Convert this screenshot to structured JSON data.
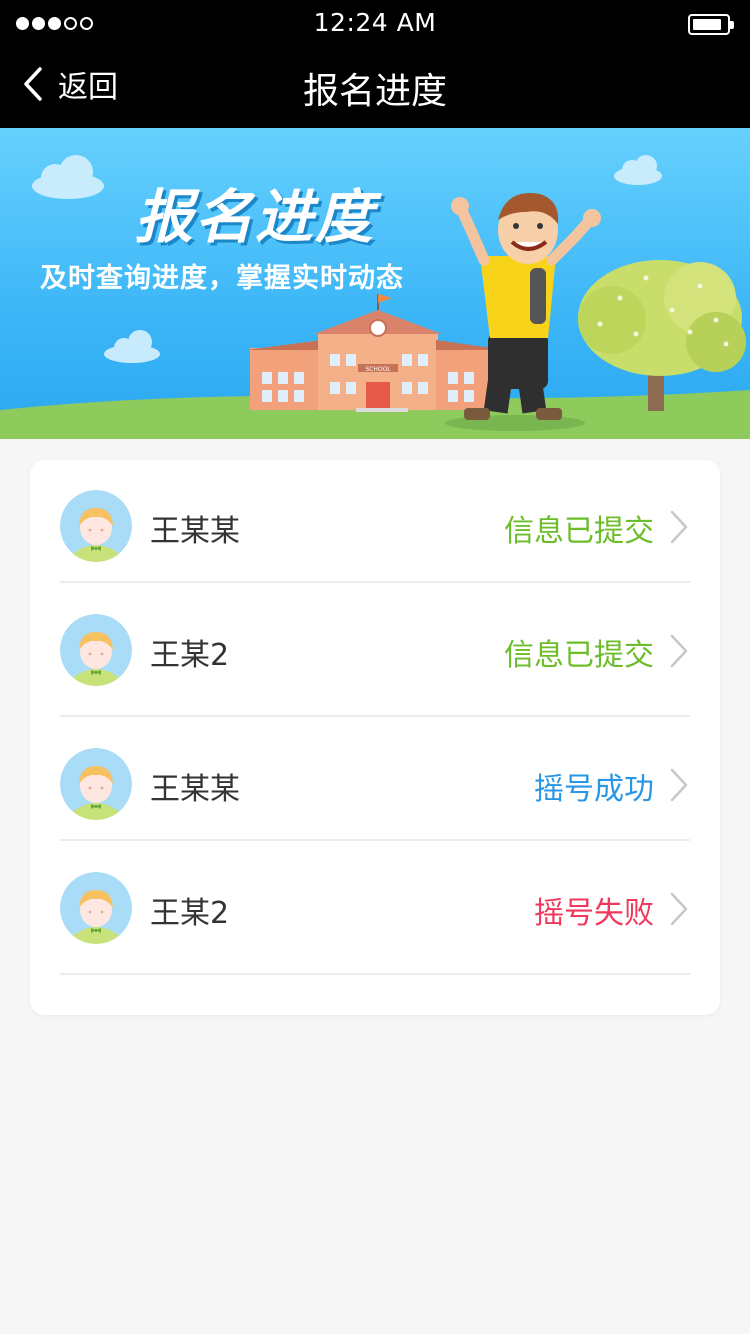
{
  "status_bar": {
    "time": "12:24 AM",
    "signal_bars": 3,
    "signal_total": 5
  },
  "nav": {
    "back_label": "返回",
    "title": "报名进度"
  },
  "banner": {
    "title": "报名进度",
    "subtitle": "及时查询进度，掌握实时动态",
    "building_sign": "SCHOOL"
  },
  "colors": {
    "submitted": "#6bbd2a",
    "success": "#2a96e6",
    "failed": "#f0385c",
    "nav_bg": "#000000"
  },
  "records": [
    {
      "name": "王某某",
      "status": "信息已提交",
      "status_type": "submitted"
    },
    {
      "name": "王某2",
      "status": "信息已提交",
      "status_type": "submitted"
    },
    {
      "name": "王某某",
      "status": "摇号成功",
      "status_type": "success"
    },
    {
      "name": "王某2",
      "status": "摇号失败",
      "status_type": "failed"
    }
  ]
}
